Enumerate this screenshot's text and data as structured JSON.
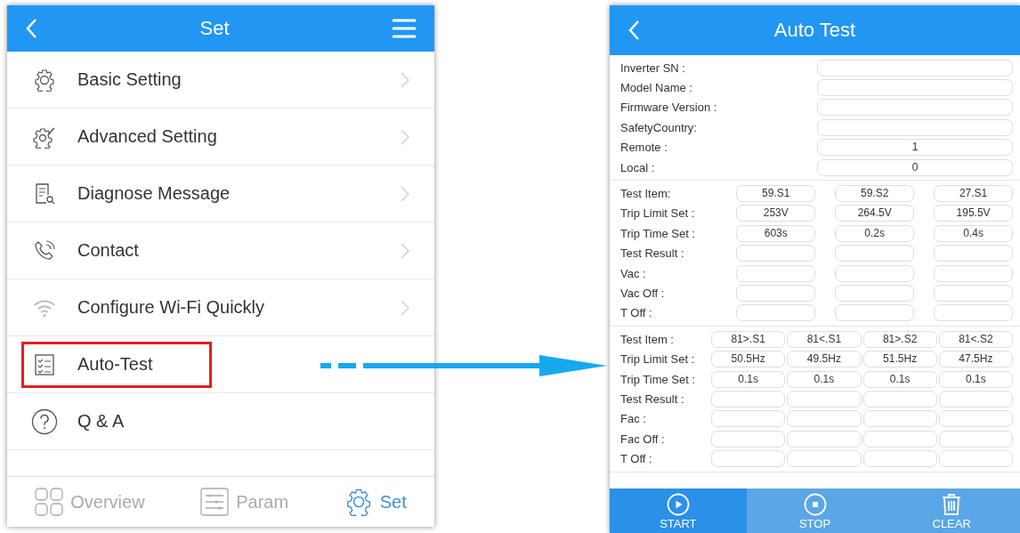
{
  "set_screen": {
    "title": "Set",
    "items": [
      {
        "label": "Basic Setting",
        "chevron": true,
        "highlighted": false
      },
      {
        "label": "Advanced Setting",
        "chevron": true,
        "highlighted": false
      },
      {
        "label": "Diagnose Message",
        "chevron": true,
        "highlighted": false
      },
      {
        "label": "Contact",
        "chevron": true,
        "highlighted": false
      },
      {
        "label": "Configure Wi-Fi Quickly",
        "chevron": true,
        "highlighted": false
      },
      {
        "label": "Auto-Test",
        "chevron": false,
        "highlighted": true
      },
      {
        "label": "Q & A",
        "chevron": false,
        "highlighted": false
      }
    ],
    "tabs": [
      {
        "label": "Overview",
        "selected": false
      },
      {
        "label": "Param",
        "selected": false
      },
      {
        "label": "Set",
        "selected": true
      }
    ]
  },
  "auto_test": {
    "title": "Auto Test",
    "info_fields": [
      {
        "label": "Inverter SN :"
      },
      {
        "label": "Model Name :"
      },
      {
        "label": "Firmware Version :"
      },
      {
        "label": "SafetyCountry:"
      },
      {
        "label": "Remote :",
        "value": "1"
      },
      {
        "label": "Local :",
        "value": "0"
      }
    ],
    "voltage_table": {
      "rows": [
        {
          "label": "Test Item:",
          "cells": [
            "59.S1",
            "59.S2",
            "27.S1"
          ]
        },
        {
          "label": "Trip Limit Set :",
          "cells": [
            "253V",
            "264.5V",
            "195.5V"
          ]
        },
        {
          "label": "Trip Time Set :",
          "cells": [
            "603s",
            "0.2s",
            "0.4s"
          ]
        },
        {
          "label": "Test Result :"
        },
        {
          "label": "Vac :"
        },
        {
          "label": "Vac Off :"
        },
        {
          "label": "T Off :"
        }
      ]
    },
    "frequency_table": {
      "rows": [
        {
          "label": "Test Item :",
          "cells": [
            "81>.S1",
            "81<.S1",
            "81>.S2",
            "81<.S2"
          ]
        },
        {
          "label": "Trip Limit Set :",
          "cells": [
            "50.5Hz",
            "49.5Hz",
            "51.5Hz",
            "47.5Hz"
          ]
        },
        {
          "label": "Trip Time Set :",
          "cells": [
            "0.1s",
            "0.1s",
            "0.1s",
            "0.1s"
          ]
        },
        {
          "label": "Test Result :"
        },
        {
          "label": "Fac :"
        },
        {
          "label": "Fac Off :"
        },
        {
          "label": "T Off :"
        }
      ]
    },
    "actions": [
      {
        "label": "START",
        "selected": true
      },
      {
        "label": "STOP",
        "selected": false
      },
      {
        "label": "CLEAR",
        "selected": false
      }
    ]
  }
}
